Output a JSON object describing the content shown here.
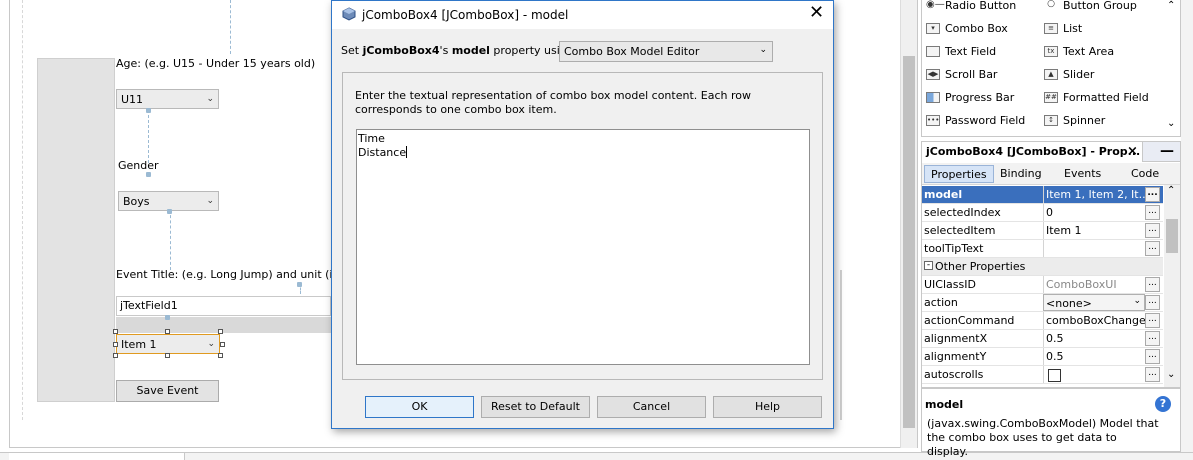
{
  "designer": {
    "age_label": "Age: (e.g. U15 - Under 15 years old)",
    "age_combo": "U11",
    "gender_label": "Gender",
    "gender_combo": "Boys",
    "event_label": "Event Title:  (e.g. Long Jump) and unit (i.e. T",
    "event_field": "jTextField1",
    "selected_combo": "Item 1",
    "save_button": "Save Event"
  },
  "dialog": {
    "title": "jComboBox4 [JComboBox] - model",
    "set_prefix": "Set ",
    "set_component": "jComboBox4",
    "set_mid": "'s ",
    "set_property": "model",
    "set_suffix": " property using:",
    "editor_selected": "Combo Box Model Editor",
    "instructions": "Enter the textual representation of combo box model content. Each row corresponds to one combo box item.",
    "textarea_lines": [
      "Time",
      "Distance"
    ],
    "buttons": {
      "ok": "OK",
      "reset": "Reset to Default",
      "cancel": "Cancel",
      "help": "Help"
    }
  },
  "palette": {
    "items": [
      {
        "label": "Radio Button",
        "icon": "radio-button-icon"
      },
      {
        "label": "Button Group",
        "icon": "button-group-icon"
      },
      {
        "label": "Combo Box",
        "icon": "combo-box-icon"
      },
      {
        "label": "List",
        "icon": "list-icon"
      },
      {
        "label": "Text Field",
        "icon": "text-field-icon"
      },
      {
        "label": "Text Area",
        "icon": "text-area-icon"
      },
      {
        "label": "Scroll Bar",
        "icon": "scroll-bar-icon"
      },
      {
        "label": "Slider",
        "icon": "slider-icon"
      },
      {
        "label": "Progress Bar",
        "icon": "progress-bar-icon"
      },
      {
        "label": "Formatted Field",
        "icon": "formatted-field-icon"
      },
      {
        "label": "Password Field",
        "icon": "password-field-icon"
      },
      {
        "label": "Spinner",
        "icon": "spinner-icon"
      }
    ]
  },
  "properties": {
    "title": "jComboBox4 [JComboBox] - Prop...",
    "tabs": [
      "Properties",
      "Binding",
      "Events",
      "Code"
    ],
    "rows": [
      {
        "name": "model",
        "value": "Item 1, Item 2, It..."
      },
      {
        "name": "selectedIndex",
        "value": "0"
      },
      {
        "name": "selectedItem",
        "value": "Item 1"
      },
      {
        "name": "toolTipText",
        "value": ""
      },
      {
        "name": "Other Properties",
        "value": ""
      },
      {
        "name": "UIClassID",
        "value": "ComboBoxUI"
      },
      {
        "name": "action",
        "value": "<none>"
      },
      {
        "name": "actionCommand",
        "value": "comboBoxChanged"
      },
      {
        "name": "alignmentX",
        "value": "0.5"
      },
      {
        "name": "alignmentY",
        "value": "0.5"
      },
      {
        "name": "autoscrolls",
        "value": ""
      }
    ],
    "help_title": "model",
    "help_text": "(javax.swing.ComboBoxModel) Model that the combo box uses to get data to display."
  }
}
